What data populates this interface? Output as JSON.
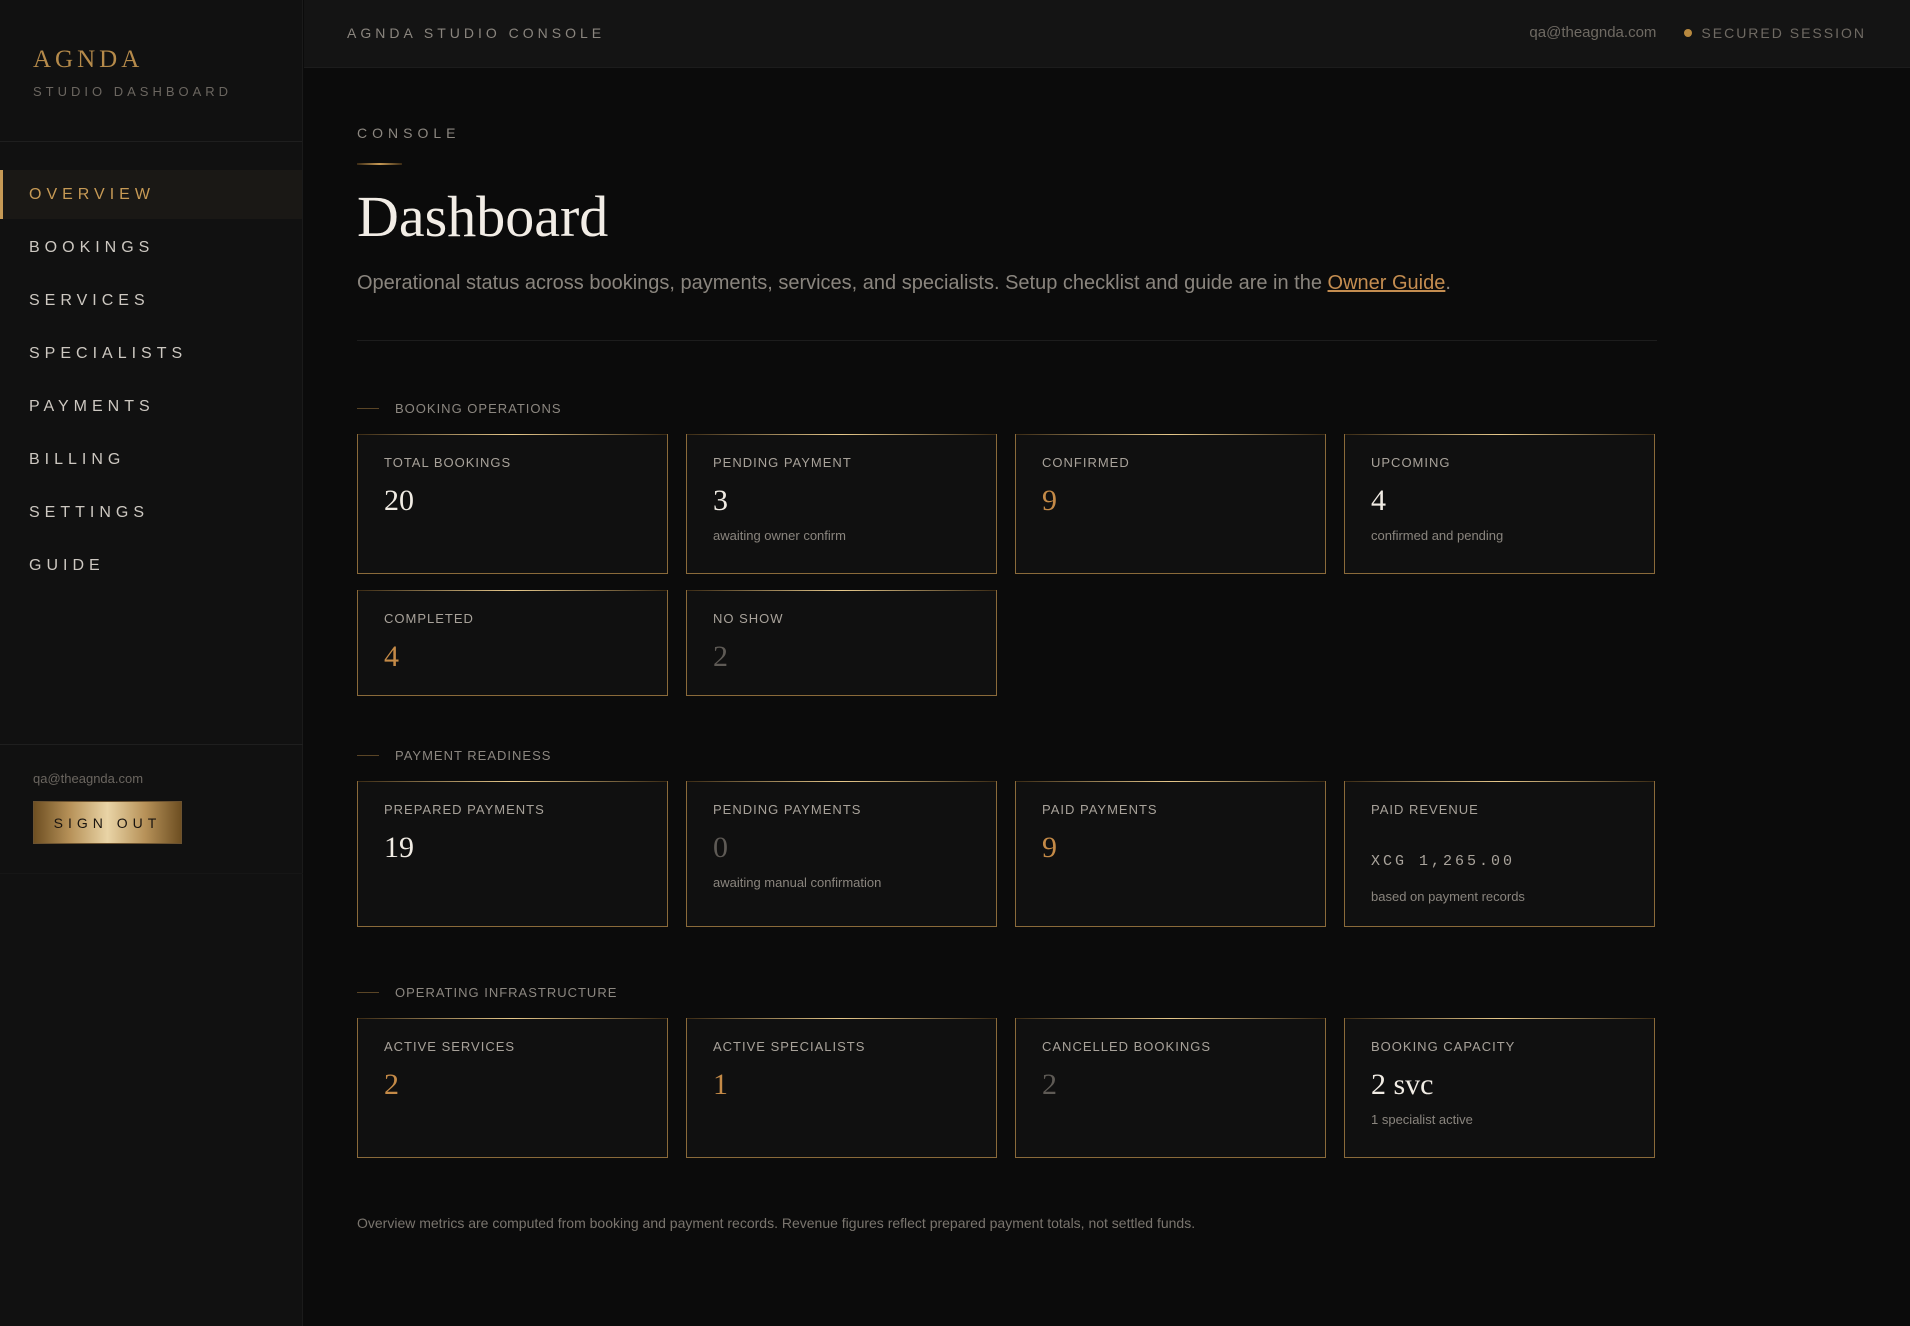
{
  "sidebar": {
    "brand": "AGNDA",
    "brand_sub": "STUDIO DASHBOARD",
    "nav": [
      {
        "label": "OVERVIEW",
        "active": true
      },
      {
        "label": "BOOKINGS",
        "active": false
      },
      {
        "label": "SERVICES",
        "active": false
      },
      {
        "label": "SPECIALISTS",
        "active": false
      },
      {
        "label": "PAYMENTS",
        "active": false
      },
      {
        "label": "BILLING",
        "active": false
      },
      {
        "label": "SETTINGS",
        "active": false
      },
      {
        "label": "GUIDE",
        "active": false
      }
    ],
    "email": "qa@theagnda.com",
    "signout": "SIGN OUT"
  },
  "topbar": {
    "title": "AGNDA STUDIO CONSOLE",
    "email": "qa@theagnda.com",
    "session": "SECURED SESSION"
  },
  "header": {
    "eyebrow": "CONSOLE",
    "title": "Dashboard",
    "subtitle_prefix": "Operational status across bookings, payments, services, and specialists. Setup checklist and guide are in the ",
    "subtitle_link": "Owner Guide",
    "subtitle_suffix": "."
  },
  "sections": {
    "booking": {
      "label": "BOOKING OPERATIONS",
      "cards": [
        {
          "label": "TOTAL BOOKINGS",
          "value": "20",
          "note": ""
        },
        {
          "label": "PENDING PAYMENT",
          "value": "3",
          "note": "awaiting owner confirm"
        },
        {
          "label": "CONFIRMED",
          "value": "9",
          "note": ""
        },
        {
          "label": "UPCOMING",
          "value": "4",
          "note": "confirmed and pending"
        },
        {
          "label": "COMPLETED",
          "value": "4",
          "note": ""
        },
        {
          "label": "NO SHOW",
          "value": "2",
          "note": ""
        }
      ]
    },
    "payment": {
      "label": "PAYMENT READINESS",
      "cards": [
        {
          "label": "PREPARED PAYMENTS",
          "value": "19",
          "note": ""
        },
        {
          "label": "PENDING PAYMENTS",
          "value": "0",
          "note": "awaiting manual confirmation"
        },
        {
          "label": "PAID PAYMENTS",
          "value": "9",
          "note": ""
        },
        {
          "label": "PAID REVENUE",
          "value": "XCG 1,265.00",
          "note": "based on payment records"
        }
      ]
    },
    "infra": {
      "label": "OPERATING INFRASTRUCTURE",
      "cards": [
        {
          "label": "ACTIVE SERVICES",
          "value": "2",
          "note": ""
        },
        {
          "label": "ACTIVE SPECIALISTS",
          "value": "1",
          "note": ""
        },
        {
          "label": "CANCELLED BOOKINGS",
          "value": "2",
          "note": ""
        },
        {
          "label": "BOOKING CAPACITY",
          "value": "2 svc",
          "note": "1 specialist active"
        }
      ]
    }
  },
  "footnote": "Overview metrics are computed from booking and payment records. Revenue figures reflect prepared payment totals, not settled funds.",
  "colors": {
    "accent": "#c79a55",
    "background": "#0b0b0b",
    "card_border": "#8a6a3a"
  }
}
